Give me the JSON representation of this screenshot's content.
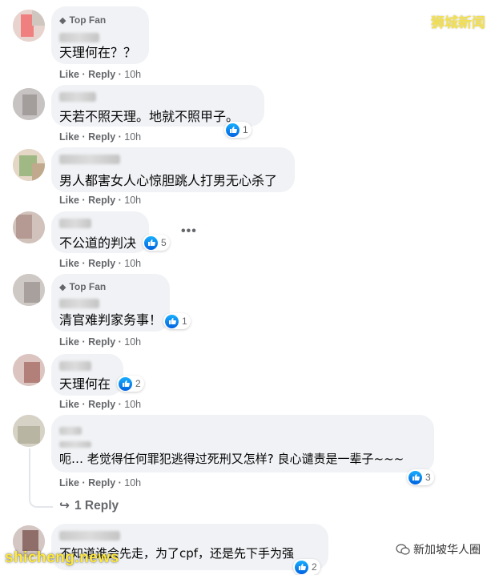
{
  "watermark_top": "狮城新闻",
  "watermark_bottom_left": "shicheng.news",
  "watermark_bottom_right": "新加坡华人圈",
  "badge_label": "Top Fan",
  "actions": {
    "like": "Like",
    "reply": "Reply"
  },
  "comments": [
    {
      "text": "天理何在？？",
      "time": "10h",
      "top_fan": true
    },
    {
      "text": "天若不照天理。地就不照甲子。",
      "time": "10h",
      "reactions": "1"
    },
    {
      "text": "男人都害女人心惊胆跳人打男无心杀了",
      "time": "10h"
    },
    {
      "text": "不公道的判决",
      "time": "10h",
      "reactions": "5",
      "more": "•••"
    },
    {
      "text": "清官难判家务事！",
      "time": "10h",
      "top_fan": true,
      "reactions": "1"
    },
    {
      "text": "天理何在",
      "time": "10h",
      "reactions": "2"
    },
    {
      "text": "呃… 老觉得任何罪犯逃得过死刑又怎样? 良心谴责是一辈子~~~",
      "time": "10h",
      "reactions": "3",
      "replies_link": "1 Reply"
    },
    {
      "text": "不知道谁会先走，为了cpf，还是先下手为强",
      "reactions": "2"
    }
  ]
}
